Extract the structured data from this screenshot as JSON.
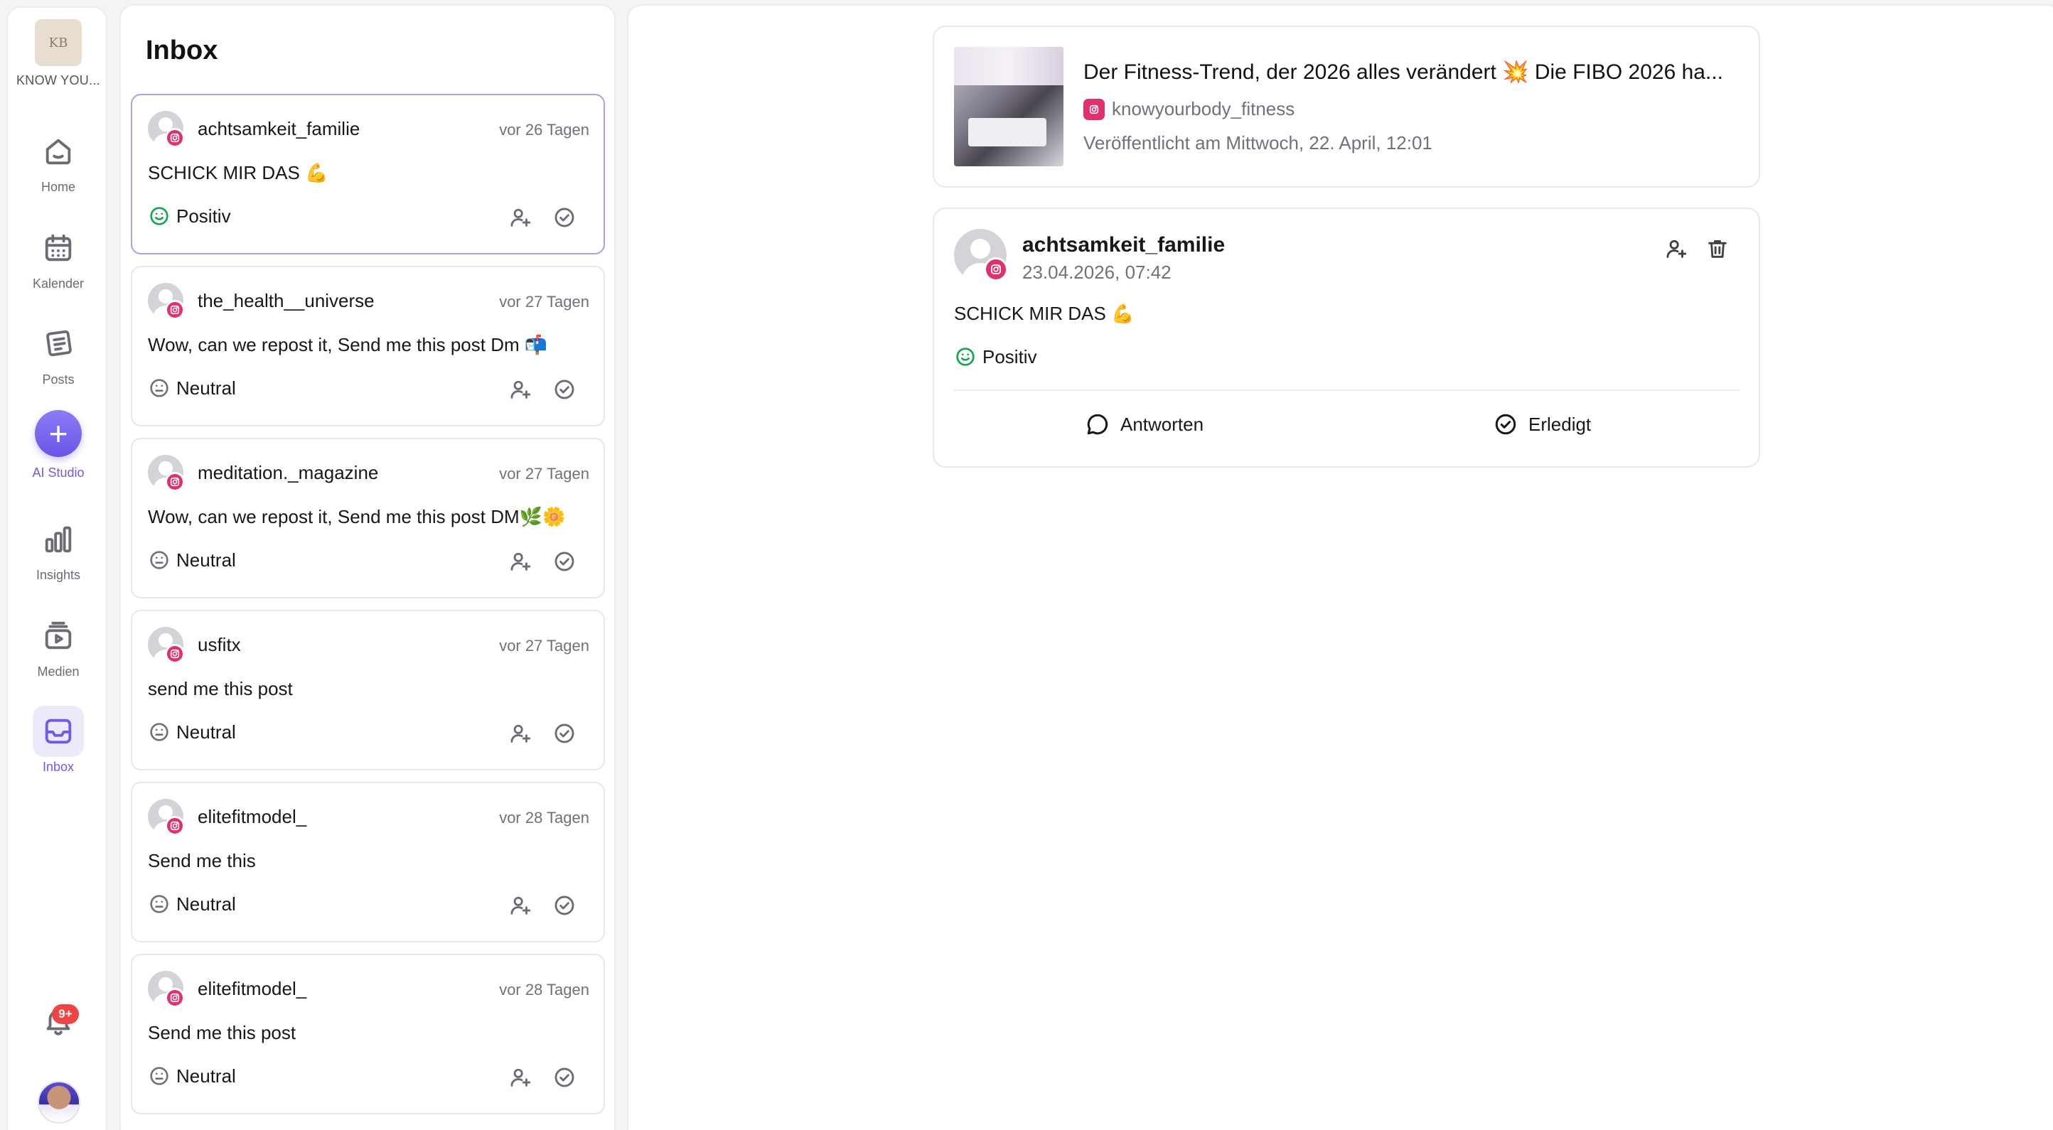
{
  "brand": {
    "logo_text": "KB",
    "name": "KNOW YOU..."
  },
  "nav": {
    "home": "Home",
    "calendar": "Kalender",
    "posts": "Posts",
    "ai_studio": "AI Studio",
    "insights": "Insights",
    "media": "Medien",
    "inbox": "Inbox"
  },
  "notifications": {
    "badge": "9+"
  },
  "inbox": {
    "title": "Inbox",
    "items": [
      {
        "username": "achtsamkeit_familie",
        "time": "vor 26 Tagen",
        "message": "SCHICK MIR DAS 💪",
        "sentiment": "Positiv",
        "selected": true
      },
      {
        "username": "the_health__universe",
        "time": "vor 27 Tagen",
        "message": "Wow, can we repost it, Send me this post Dm 📬",
        "sentiment": "Neutral"
      },
      {
        "username": "meditation._magazine",
        "time": "vor 27 Tagen",
        "message": "Wow, can we repost it, Send me this post DM🌿🌼",
        "sentiment": "Neutral"
      },
      {
        "username": "usfitx",
        "time": "vor 27 Tagen",
        "message": "send me this post",
        "sentiment": "Neutral"
      },
      {
        "username": "elitefitmodel_",
        "time": "vor 28 Tagen",
        "message": "Send me this",
        "sentiment": "Neutral"
      },
      {
        "username": "elitefitmodel_",
        "time": "vor 28 Tagen",
        "message": "Send me this post",
        "sentiment": "Neutral"
      }
    ]
  },
  "post": {
    "title": "Der Fitness-Trend, der 2026 alles verändert 💥 Die FIBO 2026 ha...",
    "author": "knowyourbody_fitness",
    "published": "Veröffentlicht am Mittwoch, 22. April, 12:01"
  },
  "comment": {
    "username": "achtsamkeit_familie",
    "timestamp": "23.04.2026, 07:42",
    "message": "SCHICK MIR DAS 💪",
    "sentiment": "Positiv",
    "reply_label": "Antworten",
    "resolve_label": "Erledigt"
  },
  "colors": {
    "accent": "#6d5ce6",
    "instagram": "#e1306c",
    "positive": "#16a34a",
    "badge": "#ef4444"
  }
}
